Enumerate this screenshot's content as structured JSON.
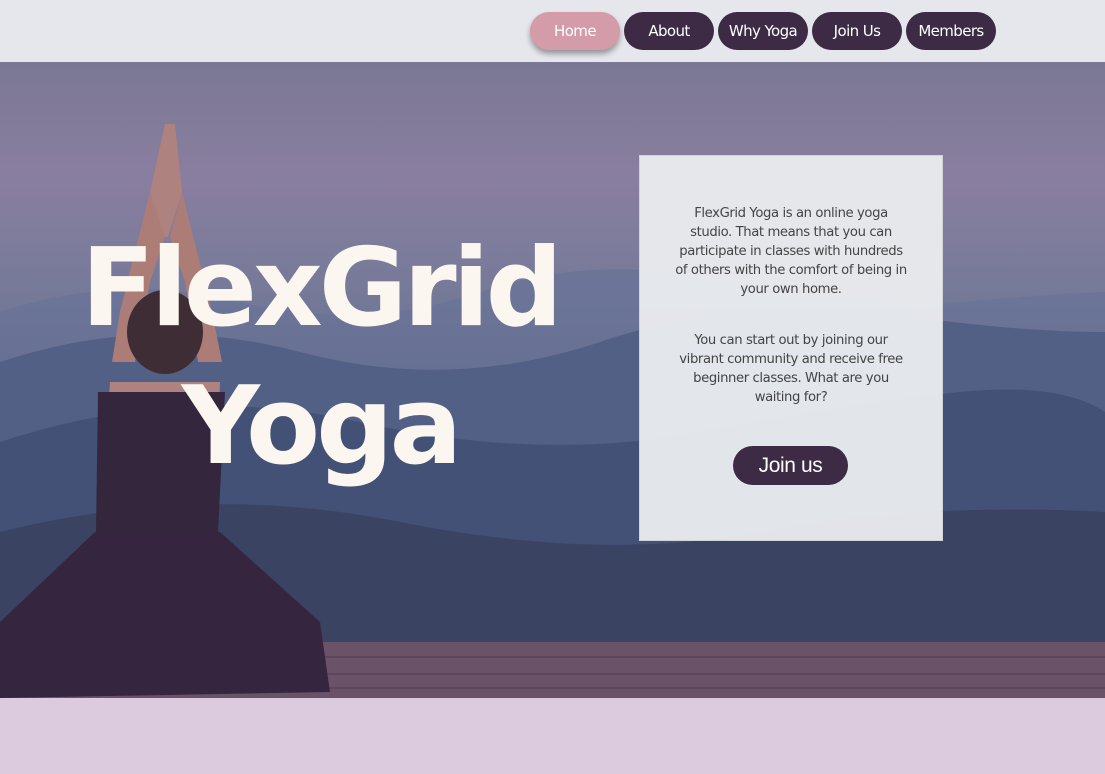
{
  "nav": {
    "items": [
      {
        "label": "Home",
        "active": true
      },
      {
        "label": "About",
        "active": false
      },
      {
        "label": "Why Yoga",
        "active": false
      },
      {
        "label": "Join Us",
        "active": false
      },
      {
        "label": "Members",
        "active": false
      }
    ]
  },
  "hero": {
    "title_line1": "FlexGrid",
    "title_line2": "Yoga"
  },
  "card": {
    "paragraph1": "FlexGrid Yoga is an online yoga studio. That means that you can participate in classes with hundreds of others with the comfort of being in your own home.",
    "paragraph2": "You can start out by joining our vibrant community and receive free beginner classes. What are you waiting for?",
    "cta_label": "Join us"
  },
  "colors": {
    "nav_bg": "#3d2a45",
    "nav_active": "#d49ba9",
    "topbar": "#e6e7ec",
    "footer_band": "#dccade",
    "title_text": "#fbf6ef"
  }
}
